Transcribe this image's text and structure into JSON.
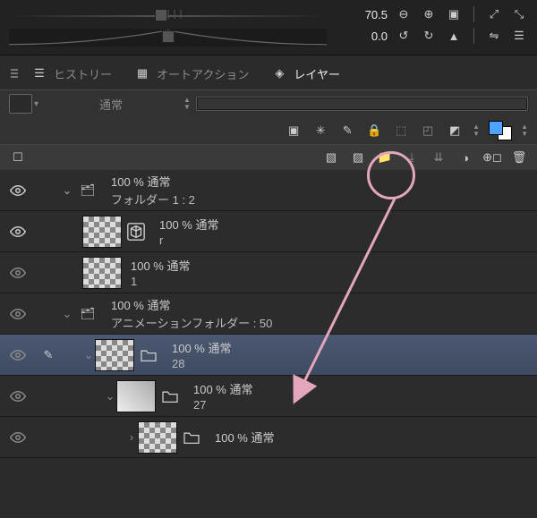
{
  "nav": {
    "scale_value": "70.5",
    "rotate_value": "0.0"
  },
  "tabs": {
    "history": "ヒストリー",
    "autoaction": "オートアクション",
    "layer": "レイヤー"
  },
  "blend": {
    "mode": "通常"
  },
  "layers": [
    {
      "id": "folder1",
      "kind": "folder",
      "visible": true,
      "expanded": true,
      "indent": 0,
      "opacity_label": "100 % 通常",
      "name": "フォルダー 1 : 2"
    },
    {
      "id": "r",
      "kind": "layer",
      "visible": true,
      "indent": 1,
      "has_3d": true,
      "opacity_label": "100 % 通常",
      "name": "r"
    },
    {
      "id": "l1",
      "kind": "layer",
      "visible": "dim",
      "indent": 1,
      "opacity_label": "100 % 通常",
      "name": "1"
    },
    {
      "id": "animfolder",
      "kind": "folder",
      "visible": "dim",
      "expanded": true,
      "indent": 0,
      "opacity_label": "100 % 通常",
      "name": "アニメーションフォルダー : 50"
    },
    {
      "id": "l28",
      "kind": "layer-folder",
      "visible": "dim",
      "expanded": true,
      "selected": true,
      "editing": true,
      "indent": 1,
      "opacity_label": "100 % 通常",
      "name": "28"
    },
    {
      "id": "l27",
      "kind": "layer-folder",
      "visible": "dim",
      "expanded": true,
      "indent": 2,
      "thumb": "img",
      "opacity_label": "100 % 通常",
      "name": "27"
    },
    {
      "id": "l-next",
      "kind": "layer-folder",
      "visible": "dim",
      "indent": 3,
      "opacity_label": "100 % 通常",
      "name": ""
    }
  ]
}
